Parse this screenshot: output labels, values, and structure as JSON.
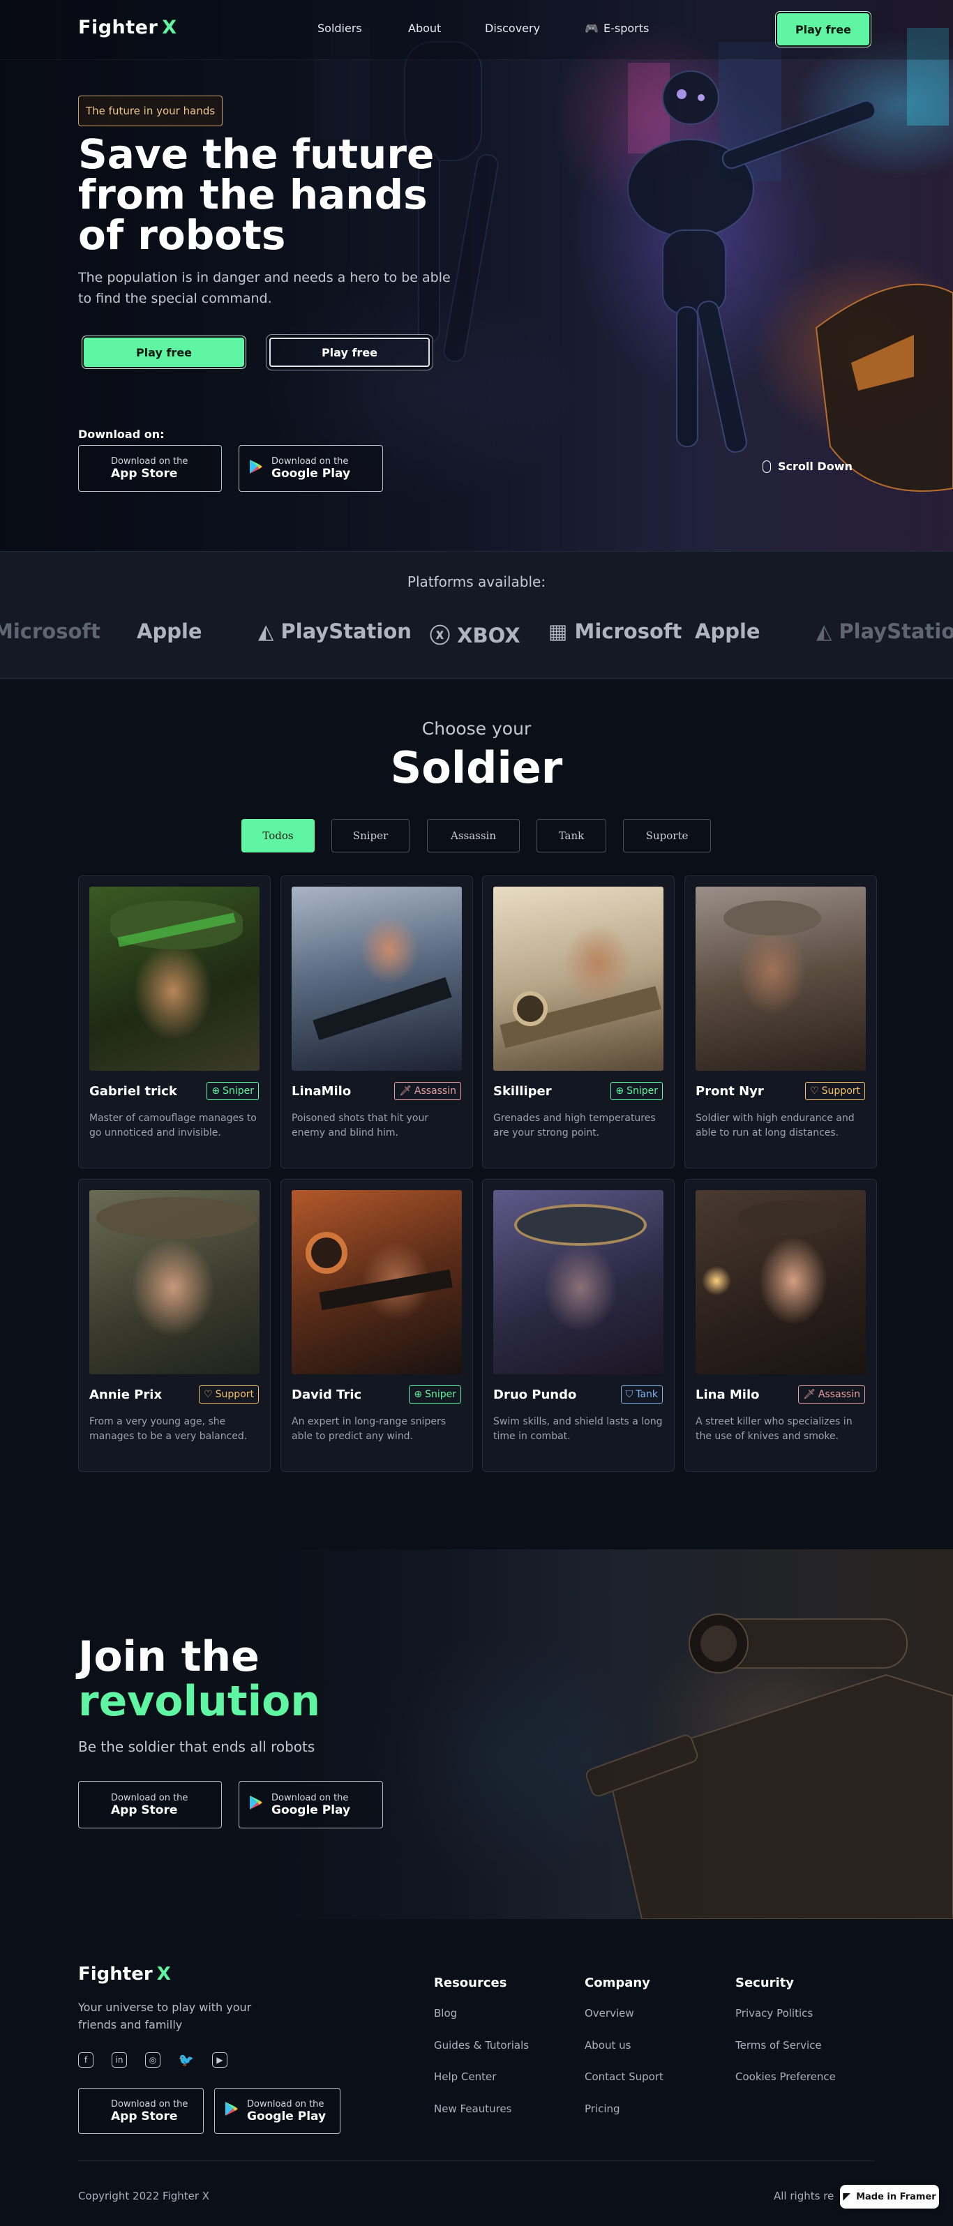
{
  "brand": {
    "name": "Fighter",
    "mark": "X",
    "accent": "#5ff5a2"
  },
  "nav": {
    "links": [
      "Soldiers",
      "About",
      "Discovery",
      "E-sports"
    ],
    "cta": "Play free"
  },
  "hero": {
    "tag": "The future in your hands",
    "title": "Save the future from the hands of robots",
    "subtitle": "The population is in danger and needs a hero to be able to find the special command.",
    "primary_cta": "Play free",
    "secondary_cta": "Play free",
    "download_label": "Download on:",
    "scroll": "Scroll Down"
  },
  "stores": {
    "app": {
      "line1": "Download on the",
      "line2": "App Store",
      "icon": "apple-icon"
    },
    "google": {
      "line1": "Download on the",
      "line2": "Google Play",
      "icon": "google-play-icon"
    }
  },
  "platforms": {
    "title": "Platforms available:",
    "logos": [
      "Microsoft",
      "Apple",
      "PlayStation",
      "XBOX",
      "Microsoft",
      "Apple",
      "PlayStation"
    ]
  },
  "soldiers": {
    "subtitle": "Choose your",
    "title": "Soldier",
    "filters": [
      "Todos",
      "Sniper",
      "Assassin",
      "Tank",
      "Suporte"
    ],
    "active_filter": "Todos",
    "cards": [
      {
        "name": "Gabriel trick",
        "role": "Sniper",
        "desc": "Master of camouflage manages to go unnoticed and invisible."
      },
      {
        "name": "LinaMilo",
        "role": "Assassin",
        "desc": "Poisoned shots that hit your enemy and blind him."
      },
      {
        "name": "Skilliper",
        "role": "Sniper",
        "desc": "Grenades and high temperatures are your strong point."
      },
      {
        "name": "Pront Nyr",
        "role": "Support",
        "desc": "Soldier with high endurance and able to run at long distances."
      },
      {
        "name": "Annie Prix",
        "role": "Support",
        "desc": "From a very young age, she manages to be a very balanced."
      },
      {
        "name": "David Tric",
        "role": "Sniper",
        "desc": "An expert in long-range snipers able to predict any wind."
      },
      {
        "name": "Druo Pundo",
        "role": "Tank",
        "desc": "Swim skills, and shield lasts a long time in combat."
      },
      {
        "name": "Lina Milo",
        "role": "Assassin",
        "desc": "A street killer who specializes in the use of knives and smoke."
      }
    ]
  },
  "join": {
    "title_line1": "Join the",
    "title_line2": "revolution",
    "subtitle": "Be the soldier that ends all robots"
  },
  "footer": {
    "tagline": "Your universe to play with your friends and familly",
    "socials": [
      "facebook-icon",
      "linkedin-icon",
      "instagram-icon",
      "twitter-icon",
      "youtube-icon"
    ],
    "columns": [
      {
        "title": "Resources",
        "items": [
          "Blog",
          "Guides & Tutorials",
          "Help Center",
          "New Feautures"
        ]
      },
      {
        "title": "Company",
        "items": [
          "Overview",
          "About us",
          "Contact Suport",
          "Pricing"
        ]
      },
      {
        "title": "Security",
        "items": [
          "Privacy Politics",
          "Terms of Service",
          "Cookies Preference"
        ]
      }
    ],
    "copyright": "Copyright 2022 Fighter X",
    "rights": "All rights re",
    "framer_badge": "Made in Framer"
  }
}
